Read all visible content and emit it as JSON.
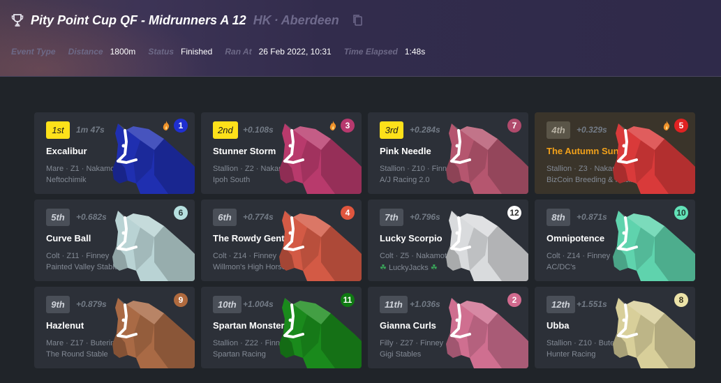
{
  "header": {
    "title": "Pity Point Cup QF - Midrunners A 12",
    "location_region": "HK",
    "location_separator": "·",
    "location_city": "Aberdeen"
  },
  "meta": {
    "event_type_label": "Event Type",
    "distance_label": "Distance",
    "distance_value": "1800m",
    "status_label": "Status",
    "status_value": "Finished",
    "ran_at_label": "Ran At",
    "ran_at_value": "26 Feb 2022, 10:31",
    "time_elapsed_label": "Time Elapsed",
    "time_elapsed_value": "1:48s"
  },
  "results": [
    {
      "position": "1st",
      "time": "1m 47s",
      "name": "Excalibur",
      "desc": "Mare · Z1 · Nakamoto",
      "stable": "Neftochimik",
      "gate": "1",
      "gate_color": "#1f2fd0",
      "gate_text": "#ffffff",
      "horse_color": "#1f2fb0",
      "flame": true,
      "badge": "gold",
      "name_color": "white",
      "highlight": false
    },
    {
      "position": "2nd",
      "time": "+0.108s",
      "name": "Stunner Storm",
      "desc": "Stallion · Z2 · Nakamoto",
      "stable": "Ipoh South",
      "gate": "3",
      "gate_color": "#b8396e",
      "gate_text": "#ffffff",
      "horse_color": "#b83a6c",
      "flame": true,
      "badge": "gold",
      "name_color": "white",
      "highlight": false
    },
    {
      "position": "3rd",
      "time": "+0.284s",
      "name": "Pink Needle",
      "desc": "Stallion · Z10 · Finney",
      "stable": "A/J Racing 2.0",
      "gate": "7",
      "gate_color": "#b04a6c",
      "gate_text": "#ffffff",
      "horse_color": "#b5566f",
      "flame": false,
      "badge": "gold",
      "name_color": "white",
      "highlight": false
    },
    {
      "position": "4th",
      "time": "+0.329s",
      "name": "The Autumn Sun",
      "desc": "Stallion · Z3 · Nakamoto",
      "stable": "BizCoin Breeding & Racing",
      "gate": "5",
      "gate_color": "#e02222",
      "gate_text": "#ffffff",
      "horse_color": "#d93a3a",
      "flame": true,
      "badge": "muted",
      "name_color": "orange",
      "highlight": true
    },
    {
      "position": "5th",
      "time": "+0.682s",
      "name": "Curve Ball",
      "desc": "Colt · Z11 · Finney",
      "stable": "Painted Valley Stable",
      "gate": "6",
      "gate_color": "#b6e0e0",
      "gate_text": "#2a3a3a",
      "horse_color": "#b9d3d4",
      "flame": false,
      "badge": "normal",
      "name_color": "white",
      "highlight": false
    },
    {
      "position": "6th",
      "time": "+0.774s",
      "name": "The Rowdy Gent",
      "desc": "Colt · Z14 · Finney",
      "stable": "Willmon's High Horses",
      "gate": "4",
      "gate_color": "#e0563e",
      "gate_text": "#ffffff",
      "horse_color": "#d35a45",
      "flame": false,
      "badge": "normal",
      "name_color": "white",
      "highlight": false
    },
    {
      "position": "7th",
      "time": "+0.796s",
      "name": "Lucky Scorpio",
      "desc": "Colt · Z5 · Nakamoto",
      "stable": "LuckyJacks",
      "gate": "12",
      "gate_color": "#ffffff",
      "gate_text": "#2a2a2a",
      "horse_color": "#d9dbdd",
      "flame": false,
      "badge": "normal",
      "name_color": "white",
      "highlight": false,
      "clover": true
    },
    {
      "position": "8th",
      "time": "+0.871s",
      "name": "Omnipotence",
      "desc": "Colt · Z14 · Finney",
      "stable": "AC/DC's",
      "gate": "10",
      "gate_color": "#62e2b8",
      "gate_text": "#1f3a30",
      "horse_color": "#5fd3ad",
      "flame": false,
      "badge": "normal",
      "name_color": "white",
      "highlight": false
    },
    {
      "position": "9th",
      "time": "+0.879s",
      "name": "Hazlenut",
      "desc": "Mare · Z17 · Buterin",
      "stable": "The Round Stable",
      "gate": "9",
      "gate_color": "#b06a3e",
      "gate_text": "#ffffff",
      "horse_color": "#a96a45",
      "flame": false,
      "badge": "normal",
      "name_color": "white",
      "highlight": false
    },
    {
      "position": "10th",
      "time": "+1.004s",
      "name": "Spartan Monster",
      "desc": "Stallion · Z22 · Finney",
      "stable": "Spartan Racing",
      "gate": "11",
      "gate_color": "#0f7a12",
      "gate_text": "#ffffff",
      "horse_color": "#1a8a1c",
      "flame": false,
      "badge": "normal",
      "name_color": "white",
      "highlight": false
    },
    {
      "position": "11th",
      "time": "+1.036s",
      "name": "Gianna Curls",
      "desc": "Filly · Z27 · Finney",
      "stable": "Gigi Stables",
      "gate": "2",
      "gate_color": "#d16a8e",
      "gate_text": "#ffffff",
      "horse_color": "#cf6f90",
      "flame": false,
      "badge": "normal",
      "name_color": "white",
      "highlight": false
    },
    {
      "position": "12th",
      "time": "+1.551s",
      "name": "Ubba",
      "desc": "Stallion · Z10 · Buterin",
      "stable": "Hunter Racing",
      "gate": "8",
      "gate_color": "#ece3a8",
      "gate_text": "#3a3520",
      "horse_color": "#d8cf9a",
      "flame": false,
      "badge": "normal",
      "name_color": "white",
      "highlight": false
    }
  ],
  "colors": {
    "accent_gold": "#fde11a",
    "name_orange": "#f2a11a",
    "flame": "#f0922a"
  }
}
